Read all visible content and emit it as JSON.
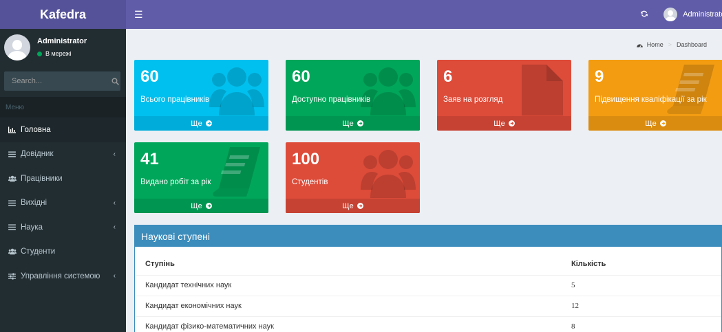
{
  "app": {
    "title": "Kafedra"
  },
  "navbar": {
    "user_name": "Administrator"
  },
  "sidebar": {
    "user_name": "Administrator",
    "status": "В мережі",
    "search_placeholder": "Search...",
    "menu_header": "Меню",
    "items": [
      {
        "label": "Головна",
        "icon": "bar-chart-icon",
        "active": true,
        "has_submenu": false
      },
      {
        "label": "Довідник",
        "icon": "list-icon",
        "active": false,
        "has_submenu": true
      },
      {
        "label": "Працівники",
        "icon": "users-icon",
        "active": false,
        "has_submenu": false
      },
      {
        "label": "Вихідні",
        "icon": "list-icon",
        "active": false,
        "has_submenu": true
      },
      {
        "label": "Наука",
        "icon": "list-icon",
        "active": false,
        "has_submenu": true
      },
      {
        "label": "Студенти",
        "icon": "users-icon",
        "active": false,
        "has_submenu": false
      },
      {
        "label": "Управління системою",
        "icon": "sliders-icon",
        "active": false,
        "has_submenu": true
      }
    ]
  },
  "breadcrumb": {
    "home": "Home",
    "current": "Dashboard"
  },
  "stats": [
    {
      "value": "60",
      "label": "Всього працівників",
      "more": "Ще",
      "color": "#00c0ef",
      "icon": "users-icon"
    },
    {
      "value": "60",
      "label": "Доступно працівників",
      "more": "Ще",
      "color": "#00a65a",
      "icon": "users-icon"
    },
    {
      "value": "6",
      "label": "Заяв на розгляд",
      "more": "Ще",
      "color": "#dd4b39",
      "icon": "document-icon"
    },
    {
      "value": "9",
      "label": "Підвищення кваліфікації за рік",
      "more": "Ще",
      "color": "#f39c12",
      "icon": "book-icon"
    },
    {
      "value": "41",
      "label": "Видано робіт за рік",
      "more": "Ще",
      "color": "#00a65a",
      "icon": "book-icon"
    },
    {
      "value": "100",
      "label": "Студентів",
      "more": "Ще",
      "color": "#dd4b39",
      "icon": "users-icon"
    }
  ],
  "degrees": {
    "title": "Наукові ступені",
    "columns": [
      "Ступінь",
      "Кількість"
    ],
    "rows": [
      {
        "degree": "Кандидат технічних наук",
        "count": "5"
      },
      {
        "degree": "Кандидат економічних наук",
        "count": "12"
      },
      {
        "degree": "Кандидат фізико-математичних наук",
        "count": "8"
      }
    ]
  }
}
